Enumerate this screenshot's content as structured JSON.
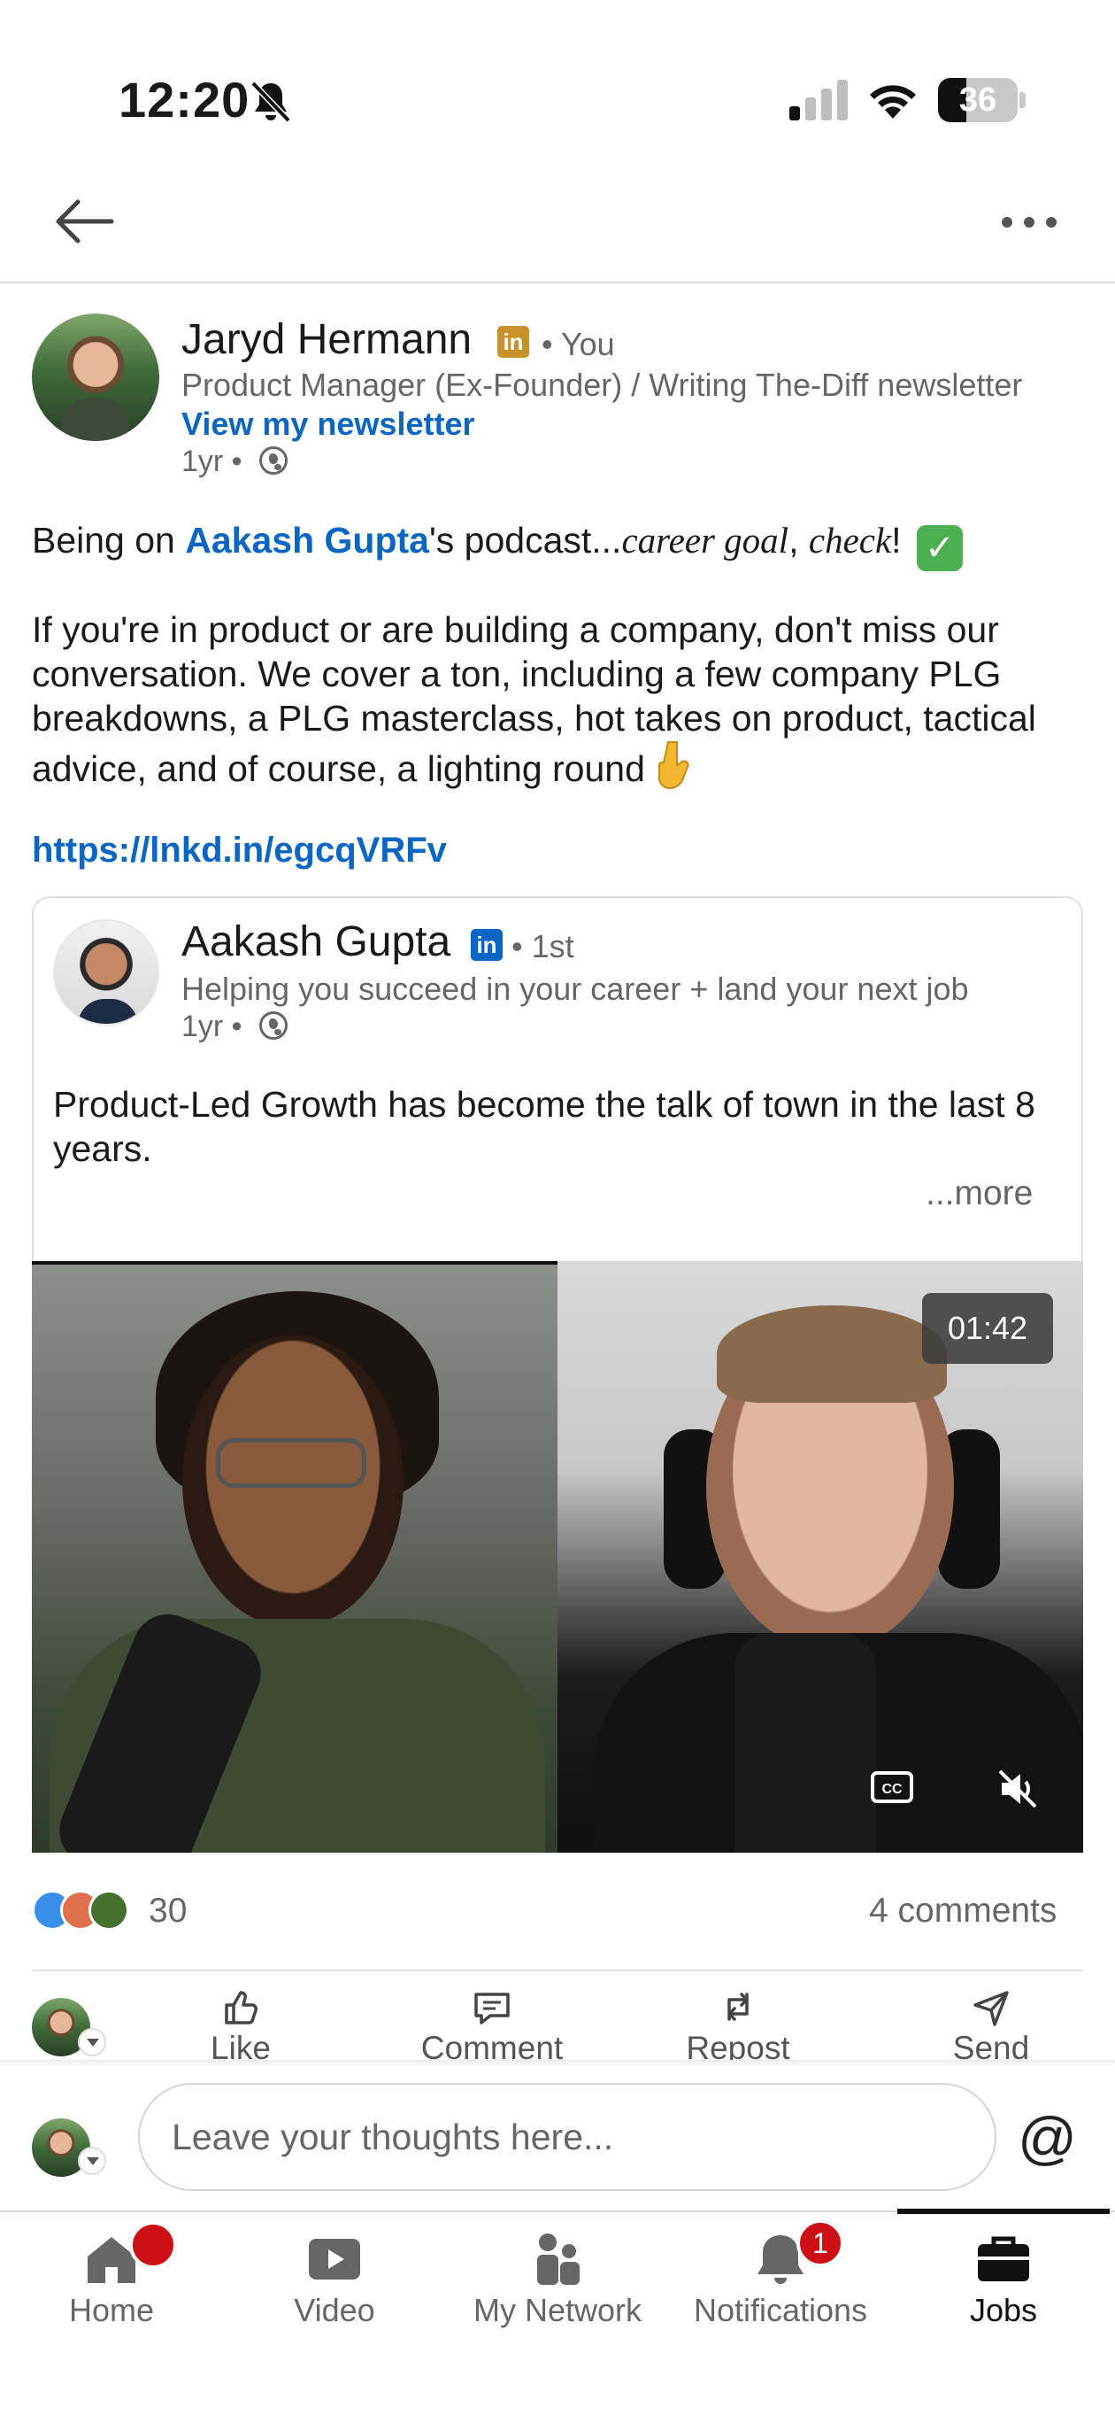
{
  "status_bar": {
    "time": "12:20",
    "battery": "36",
    "battery_level_percent": 36,
    "icons": [
      "bell-off-icon",
      "signal-icon",
      "wifi-icon",
      "battery-icon"
    ]
  },
  "header": {
    "back_icon": "arrow-left-icon",
    "more_icon": "ellipsis-icon"
  },
  "post": {
    "author": {
      "name": "Jaryd Hermann",
      "badge": "in",
      "badge_color": "#c7922c",
      "connection": "• You",
      "headline": "Product Manager (Ex-Founder) / Writing The-Diff newsletter",
      "newsletter_link": "View my newsletter",
      "time": "1yr •"
    },
    "body": {
      "line1_prefix": "Being on ",
      "mention": "Aakash Gupta",
      "line1_after_mention": "'s podcast...",
      "italic_1": "career goal",
      "comma": ", ",
      "italic_2": "check",
      "exclaim": "! ",
      "check_emoji": "✓",
      "paragraph2": "If you're in product or are building a company, don't miss our conversation. We cover a ton, including a few company PLG breakdowns, a PLG masterclass, hot takes on product, tactical advice, and of course, a lighting round",
      "url": "https://lnkd.in/egcqVRFv"
    },
    "shared": {
      "name": "Aakash Gupta",
      "badge": "in",
      "badge_color": "#0a66c2",
      "connection": "• 1st",
      "headline": "Helping you succeed in your career + land your next job",
      "time": "1yr •",
      "text": "Product-Led Growth has become the talk of town in the last 8 years.",
      "see_more": "...more",
      "video": {
        "duration": "01:42",
        "captions_icon": "cc-icon",
        "mute_icon": "speaker-muted-icon"
      }
    },
    "social": {
      "reactions": [
        "like",
        "love",
        "support"
      ],
      "reaction_count": "30",
      "comments": "4 comments"
    },
    "actions": [
      {
        "label": "Like",
        "icon": "thumbs-up-icon"
      },
      {
        "label": "Comment",
        "icon": "comment-icon"
      },
      {
        "label": "Repost",
        "icon": "repost-icon"
      },
      {
        "label": "Send",
        "icon": "send-icon"
      }
    ]
  },
  "composer": {
    "placeholder": "Leave your thoughts here...",
    "at_symbol": "@"
  },
  "bottom_nav": {
    "items": [
      {
        "label": "Home",
        "icon": "home-icon",
        "badge": "",
        "active": false
      },
      {
        "label": "Video",
        "icon": "video-icon",
        "badge": "",
        "active": false
      },
      {
        "label": "My Network",
        "icon": "network-icon",
        "badge": "",
        "active": false
      },
      {
        "label": "Notifications",
        "icon": "bell-icon",
        "badge": "1",
        "active": false
      },
      {
        "label": "Jobs",
        "icon": "briefcase-icon",
        "badge": "",
        "active": true
      }
    ]
  },
  "colors": {
    "link_blue": "#0a66c2",
    "badge_red": "#cc1016",
    "text_primary": "#1a1a1a",
    "text_secondary": "#666666"
  }
}
